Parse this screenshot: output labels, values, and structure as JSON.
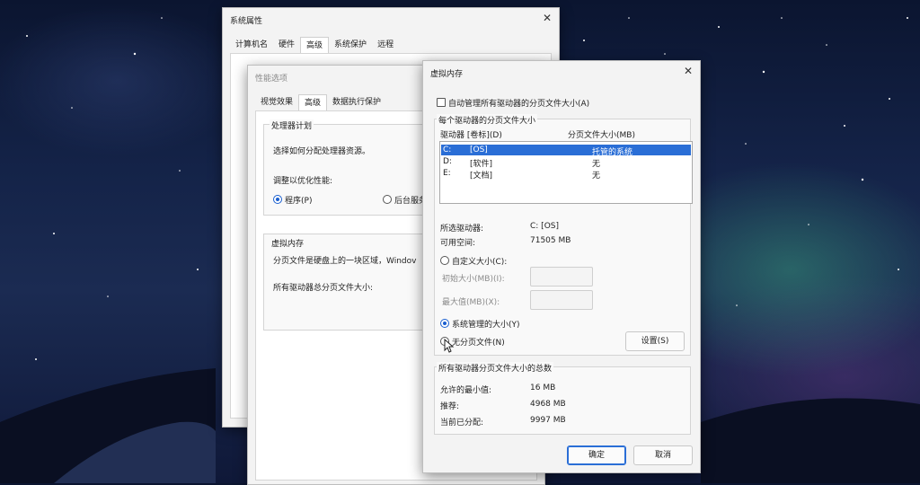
{
  "system_properties": {
    "title": "系统属性",
    "tabs": [
      "计算机名",
      "硬件",
      "高级",
      "系统保护",
      "远程"
    ],
    "active_tab": 2
  },
  "performance_options": {
    "title": "性能选项",
    "tabs": [
      "视觉效果",
      "高级",
      "数据执行保护"
    ],
    "active_tab": 1,
    "processor_group": {
      "title": "处理器计划",
      "description": "选择如何分配处理器资源。",
      "adjust_label": "调整以优化性能:",
      "option_programs": "程序(P)",
      "option_background": "后台服务("
    },
    "virtual_memory_group": {
      "title": "虚拟内存",
      "description": "分页文件是硬盘上的一块区域，Windov",
      "total_label": "所有驱动器总分页文件大小:"
    }
  },
  "virtual_memory": {
    "title": "虚拟内存",
    "close_glyph": "✕",
    "auto_manage_label": "自动管理所有驱动器的分页文件大小(A)",
    "drive_group_title": "每个驱动器的分页文件大小",
    "col_drive": "驱动器 [卷标](D)",
    "col_size": "分页文件大小(MB)",
    "drives": [
      {
        "letter": "C:",
        "label": "[OS]",
        "size": "托管的系统"
      },
      {
        "letter": "D:",
        "label": "[软件]",
        "size": "无"
      },
      {
        "letter": "E:",
        "label": "[文档]",
        "size": "无"
      }
    ],
    "selected_drive_label": "所选驱动器:",
    "selected_drive_value": "C:  [OS]",
    "free_space_label": "可用空间:",
    "free_space_value": "71505 MB",
    "custom_size_label": "自定义大小(C):",
    "initial_size_label": "初始大小(MB)(I):",
    "max_size_label": "最大值(MB)(X):",
    "system_managed_label": "系统管理的大小(Y)",
    "no_paging_label": "无分页文件(N)",
    "set_button": "设置(S)",
    "totals_group_title": "所有驱动器分页文件大小的总数",
    "min_allowed_label": "允许的最小值:",
    "min_allowed_value": "16 MB",
    "recommended_label": "推荐:",
    "recommended_value": "4968 MB",
    "current_label": "当前已分配:",
    "current_value": "9997 MB",
    "ok_button": "确定",
    "cancel_button": "取消"
  }
}
